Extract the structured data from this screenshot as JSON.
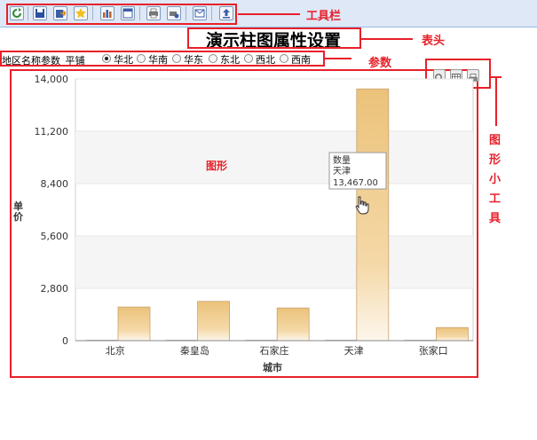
{
  "toolbar": {
    "buttons": [
      "refresh",
      "save",
      "export",
      "favorite",
      "chart",
      "window",
      "print",
      "print-setup",
      "send",
      "upload"
    ]
  },
  "annotations": {
    "toolbar": "工具栏",
    "header": "表头",
    "params": "参数",
    "chart": "图形",
    "tools": "图形小工具"
  },
  "header": {
    "title": "演示柱图属性设置"
  },
  "params": {
    "label": "地区名称参数_平铺",
    "options": [
      "华北",
      "华南",
      "华东",
      "东北",
      "西北",
      "西南"
    ],
    "selected": "华北"
  },
  "chart_tools": [
    "zoom-icon",
    "table-icon",
    "print-icon"
  ],
  "chart_data": {
    "type": "bar",
    "categories": [
      "北京",
      "秦皇岛",
      "石家庄",
      "天津",
      "张家口"
    ],
    "series": [
      {
        "values": [
          0,
          0,
          0,
          0,
          0
        ]
      },
      {
        "values": [
          1800,
          2100,
          1750,
          13467,
          700
        ]
      }
    ],
    "xlabel": "城市",
    "ylabel": "单价",
    "ylim": [
      0,
      14000
    ],
    "yticks": [
      "0",
      "2,800",
      "5,600",
      "8,400",
      "11,200",
      "14,000"
    ],
    "grid": true,
    "tooltip": {
      "series": "数量",
      "category": "天津",
      "value": "13,467.00"
    }
  }
}
